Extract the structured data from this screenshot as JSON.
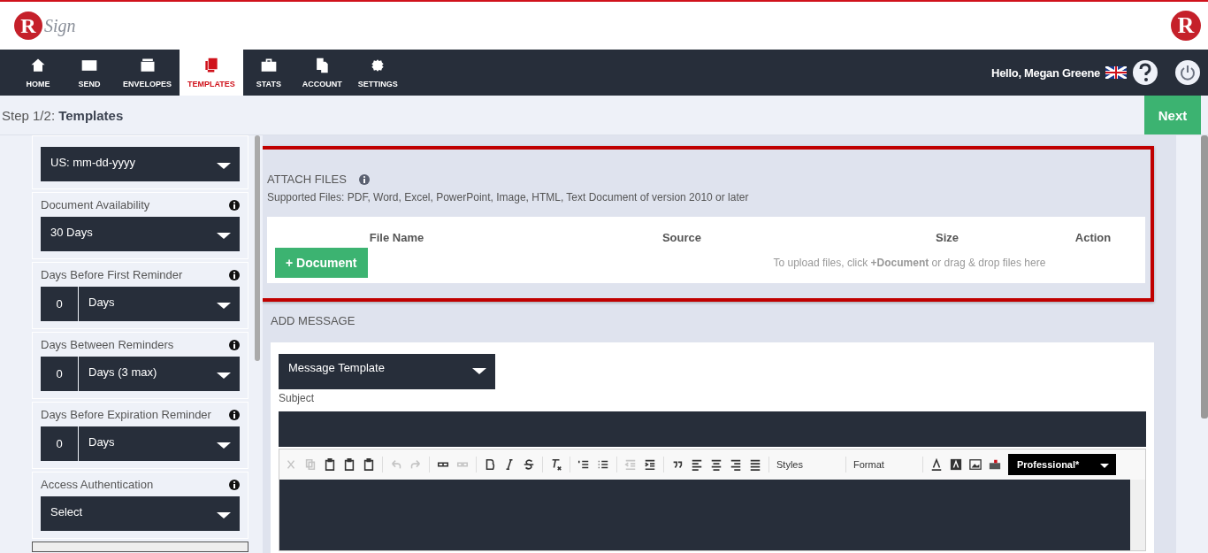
{
  "logo": {
    "mark": "R",
    "word": "Sign"
  },
  "corner_logo": {
    "mark": "R"
  },
  "nav": [
    {
      "label": "HOME",
      "selected": false
    },
    {
      "label": "SEND",
      "selected": false
    },
    {
      "label": "ENVELOPES",
      "selected": false
    },
    {
      "label": "TEMPLATES",
      "selected": true
    },
    {
      "label": "STATS",
      "selected": false
    },
    {
      "label": "ACCOUNT",
      "selected": false
    },
    {
      "label": "SETTINGS",
      "selected": false
    }
  ],
  "user": {
    "greeting": "Hello, Megan Greene"
  },
  "step": {
    "prefix": "Step 1/2:",
    "title": "Templates",
    "next": "Next"
  },
  "settings": [
    {
      "kind": "select",
      "value": "US: mm-dd-yyyy"
    },
    {
      "kind": "select",
      "label": "Document Availability",
      "value": "30 Days"
    },
    {
      "kind": "number",
      "label": "Days Before First Reminder",
      "number": "0",
      "value": "Days"
    },
    {
      "kind": "number",
      "label": "Days Between Reminders",
      "number": "0",
      "value": "Days (3 max)"
    },
    {
      "kind": "number",
      "label": "Days Before Expiration Reminder",
      "number": "0",
      "value": "Days"
    },
    {
      "kind": "select",
      "label": "Access Authentication",
      "value": "Select"
    }
  ],
  "attach": {
    "title": "ATTACH FILES",
    "supported": "Supported Files: PDF, Word, Excel, PowerPoint, Image, HTML, Text Document of version 2010 or later",
    "columns": [
      "File Name",
      "Source",
      "Size",
      "Action"
    ],
    "button": "+ Document",
    "hint": "To upload files, click **+Document** or drag & drop files here"
  },
  "message": {
    "title": "ADD MESSAGE",
    "template": "Message Template",
    "subject_label": "Subject",
    "toolbar": [
      {
        "kind": "cut",
        "disabled": true
      },
      {
        "kind": "copy",
        "disabled": true
      },
      {
        "kind": "paste",
        "disabled": false
      },
      {
        "kind": "paste",
        "disabled": false
      },
      {
        "kind": "paste",
        "disabled": false
      },
      {
        "kind": "sep"
      },
      {
        "kind": "undo",
        "disabled": true
      },
      {
        "kind": "redo",
        "disabled": true
      },
      {
        "kind": "sep"
      },
      {
        "kind": "link",
        "disabled": false
      },
      {
        "kind": "unlink",
        "disabled": true
      },
      {
        "kind": "sep"
      },
      {
        "kind": "bold",
        "disabled": false
      },
      {
        "kind": "italic",
        "disabled": false
      },
      {
        "kind": "strike",
        "disabled": false
      },
      {
        "kind": "sep"
      },
      {
        "kind": "clear",
        "disabled": false
      },
      {
        "kind": "sep"
      },
      {
        "kind": "ol",
        "disabled": false
      },
      {
        "kind": "ul",
        "disabled": false
      },
      {
        "kind": "sep"
      },
      {
        "kind": "outdent",
        "disabled": true
      },
      {
        "kind": "indent",
        "disabled": false
      },
      {
        "kind": "sep"
      },
      {
        "kind": "quote",
        "disabled": false
      },
      {
        "kind": "left",
        "disabled": false
      },
      {
        "kind": "center",
        "disabled": false
      },
      {
        "kind": "right",
        "disabled": false
      },
      {
        "kind": "justify",
        "disabled": false
      }
    ],
    "styles": "Styles",
    "format": "Format",
    "theme": "Professional*"
  }
}
